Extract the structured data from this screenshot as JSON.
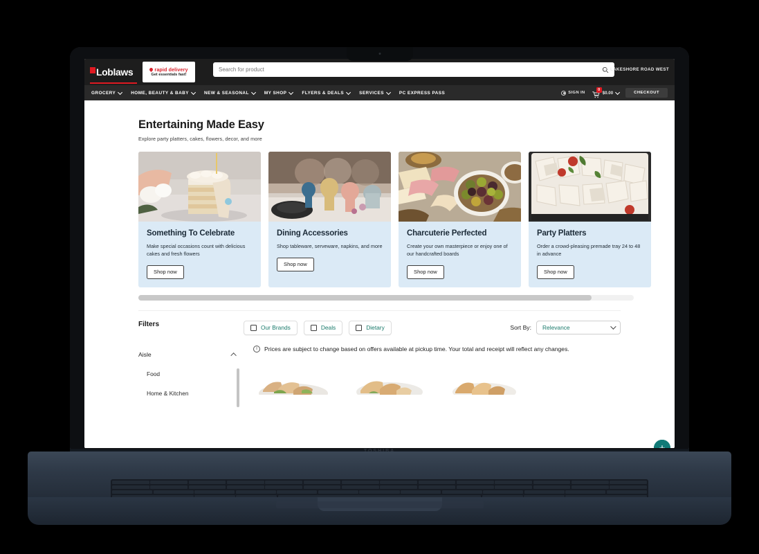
{
  "device": {
    "brand_chin": "TOSHIBA"
  },
  "header": {
    "logo": {
      "text": "Loblaws",
      "icon": "loblaws-logo-icon"
    },
    "rapid_delivery": {
      "line1": "rapid delivery",
      "line2": "Get essentials fast!",
      "icon": "pin-icon"
    },
    "search": {
      "placeholder": "Search for product",
      "value": "",
      "icon": "search-icon"
    },
    "location": {
      "label": "LAKESHORE ROAD WEST",
      "icon": "location-pin-icon"
    }
  },
  "nav": {
    "items": [
      {
        "label": "GROCERY",
        "has_chevron": true
      },
      {
        "label": "HOME, BEAUTY & BABY",
        "has_chevron": true
      },
      {
        "label": "NEW & SEASONAL",
        "has_chevron": true
      },
      {
        "label": "MY SHOP",
        "has_chevron": true
      },
      {
        "label": "FLYERS & DEALS",
        "has_chevron": true
      },
      {
        "label": "SERVICES",
        "has_chevron": true
      },
      {
        "label": "PC EXPRESS PASS",
        "has_chevron": false
      }
    ],
    "sign_in": {
      "label": "SIGN IN",
      "icon": "account-circle-icon"
    },
    "cart": {
      "icon": "cart-icon",
      "badge_count": "0",
      "amount": "$0.00"
    },
    "checkout": {
      "label": "CHECKOUT"
    }
  },
  "main": {
    "title": "Entertaining Made Easy",
    "subtitle": "Explore party platters, cakes, flowers, decor, and more",
    "cards": [
      {
        "title": "Something To Celebrate",
        "description": "Make special occasions count with delicious cakes and fresh flowers",
        "cta": "Shop now",
        "image_alt": "layered-cake-photo"
      },
      {
        "title": "Dining Accessories",
        "description": "Shop tableware, serveware, napkins, and more",
        "cta": "Shop now",
        "image_alt": "table-setting-glassware-photo"
      },
      {
        "title": "Charcuterie Perfected",
        "description": "Create your own masterpiece or enjoy one of our handcrafted boards",
        "cta": "Shop now",
        "image_alt": "charcuterie-board-photo"
      },
      {
        "title": "Party Platters",
        "description": "Order a crowd-pleasing premade tray 24 to 48 in advance",
        "cta": "Shop now",
        "image_alt": "sandwich-platter-photo"
      }
    ]
  },
  "filters": {
    "heading": "Filters",
    "chips": [
      {
        "label": "Our Brands",
        "checked": false
      },
      {
        "label": "Deals",
        "checked": false
      },
      {
        "label": "Dietary",
        "checked": false
      }
    ],
    "sort": {
      "label": "Sort By:",
      "value": "Relevance",
      "icon": "chevron-down-icon"
    },
    "sidebar": {
      "group": "Aisle",
      "expanded": true,
      "items": [
        {
          "label": "Food"
        },
        {
          "label": "Home & Kitchen"
        }
      ]
    }
  },
  "results": {
    "notice": "Prices are subject to change based on offers available at pickup time. Your total and receipt will reflect any changes.",
    "notice_icon": "info-icon",
    "products": [
      {
        "image_alt": "wrap-platter-photo",
        "add_label": "+"
      },
      {
        "image_alt": "sandwich-tray-photo",
        "add_label": "+"
      },
      {
        "image_alt": "croissant-tray-photo",
        "add_label": "+"
      }
    ]
  },
  "colors": {
    "brand_red": "#e01a22",
    "header_bg": "#1d1d1d",
    "nav_bg": "#2a2a2a",
    "card_bg": "#dbeaf6",
    "accent_teal": "#1a7a6b",
    "add_button": "#117a77"
  }
}
